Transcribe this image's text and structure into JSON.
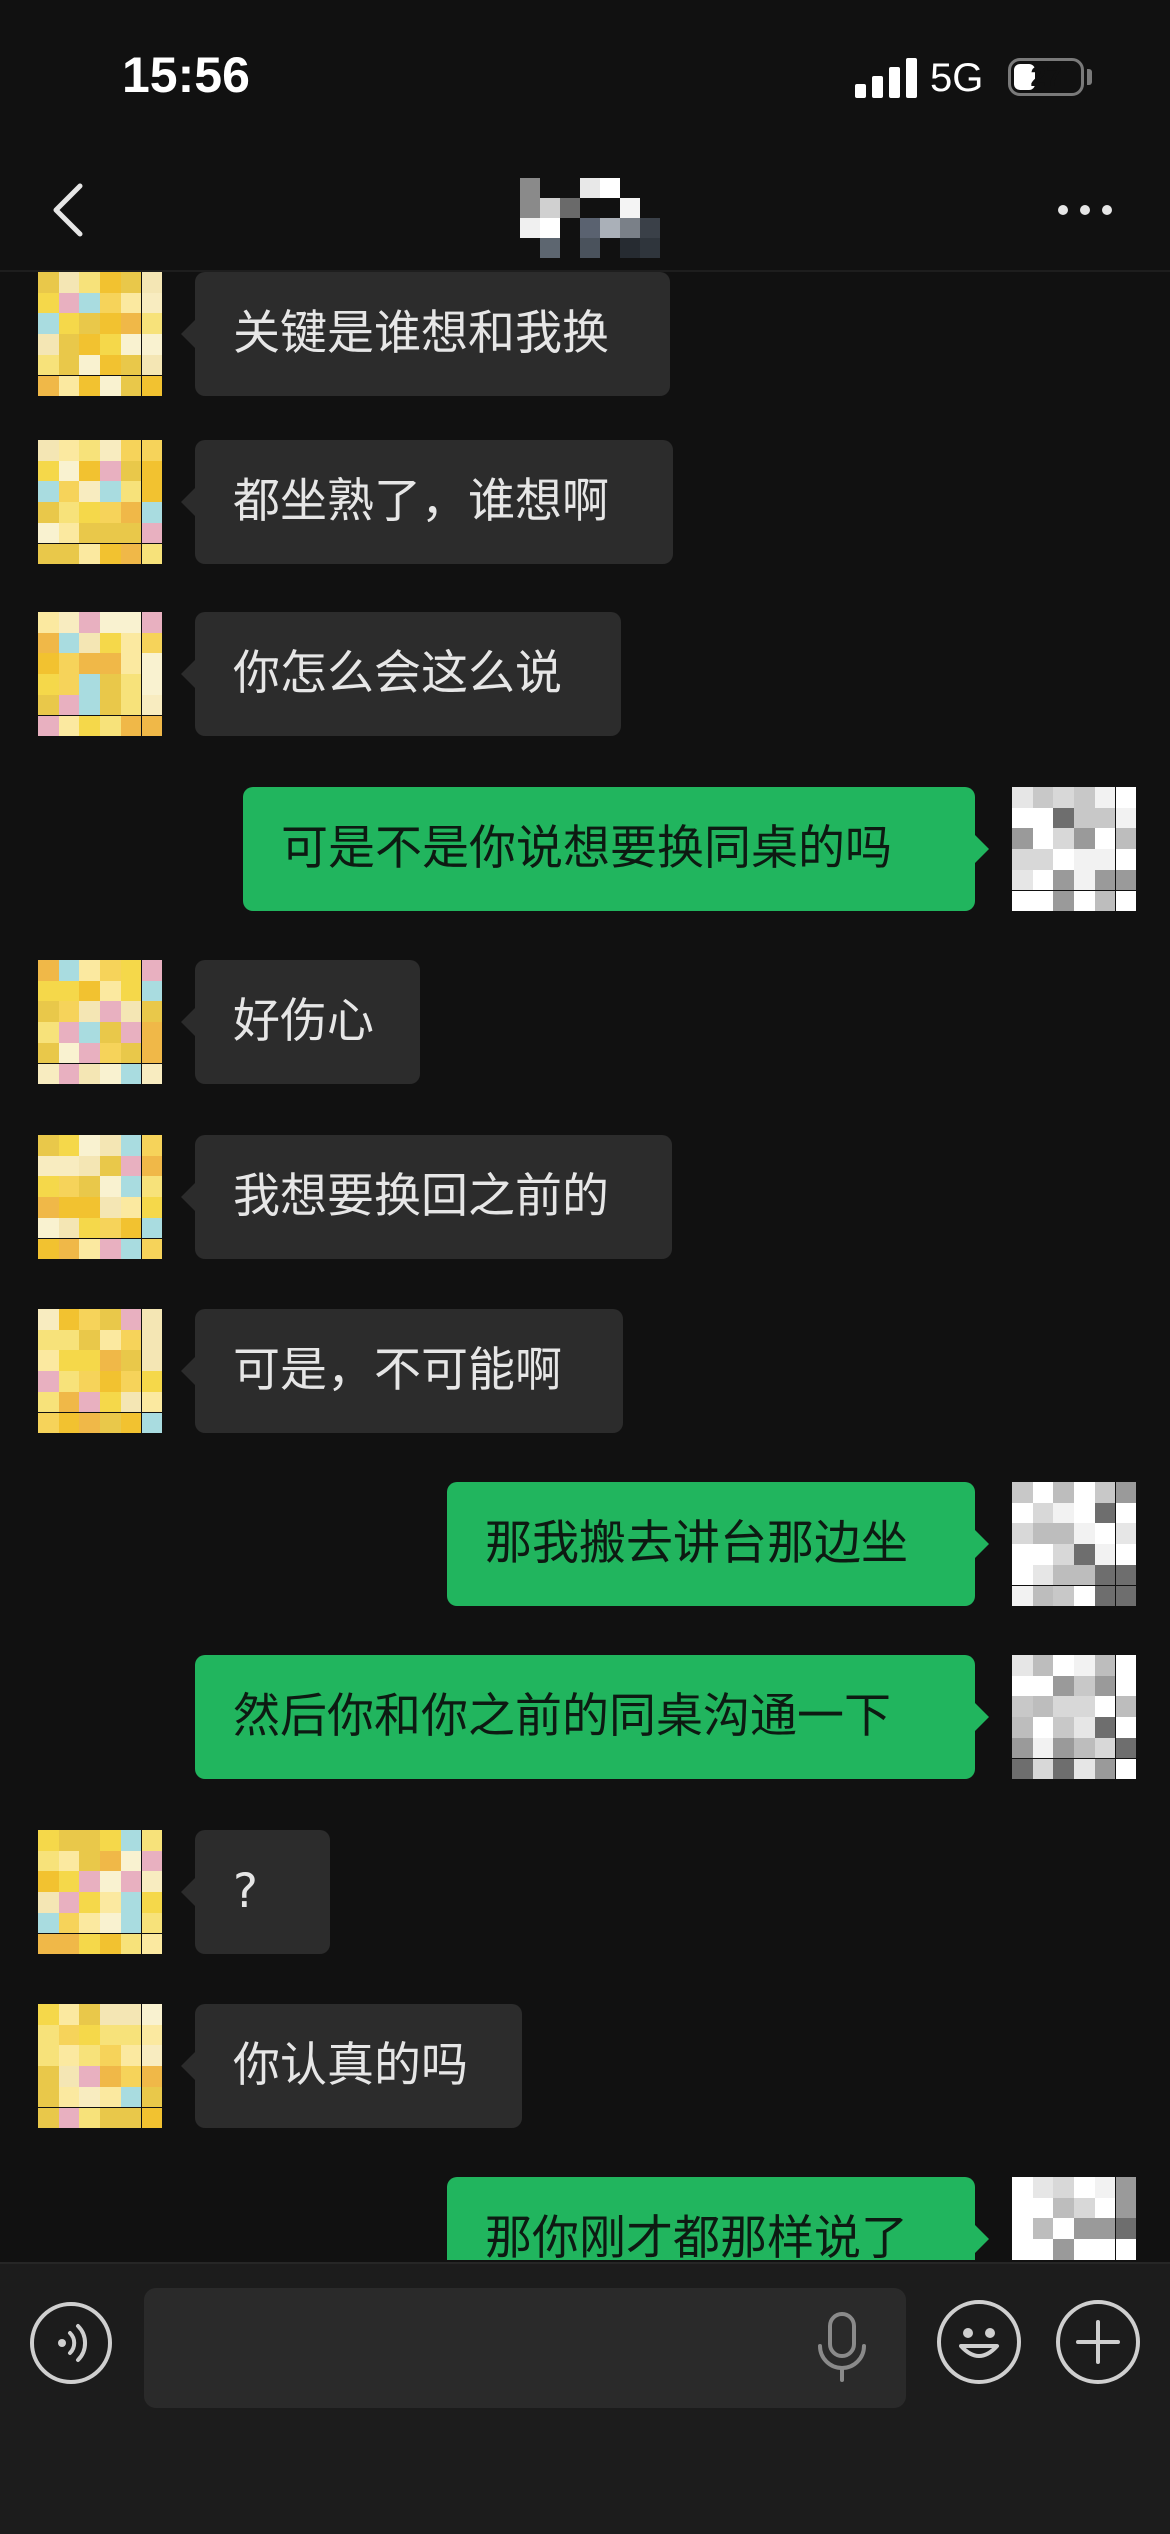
{
  "status_bar": {
    "time": "15:56",
    "network": "5G",
    "battery": "27"
  },
  "nav": {
    "title_icon": "pixelated-contact-name",
    "back_icon": "chevron-left-icon",
    "more_icon": "more-dots-icon"
  },
  "colors": {
    "background": "#111111",
    "bubble_received": "#2c2c2c",
    "bubble_sent": "#21b55e",
    "input_bar": "#1c1c1c"
  },
  "messages": [
    {
      "side": "left",
      "text": "关键是谁想和我换"
    },
    {
      "side": "left",
      "text": "都坐熟了，谁想啊"
    },
    {
      "side": "left",
      "text": "你怎么会这么说"
    },
    {
      "side": "right",
      "text": "可是不是你说想要换同桌的吗"
    },
    {
      "side": "left",
      "text": "好伤心"
    },
    {
      "side": "left",
      "text": "我想要换回之前的"
    },
    {
      "side": "left",
      "text": "可是，不可能啊"
    },
    {
      "side": "right",
      "text": "那我搬去讲台那边坐"
    },
    {
      "side": "right",
      "text": "然后你和你之前的同桌沟通一下"
    },
    {
      "side": "left",
      "text": "?"
    },
    {
      "side": "left",
      "text": "你认真的吗"
    },
    {
      "side": "right",
      "text": "那你刚才都那样说了"
    }
  ],
  "input_bar": {
    "voice_icon": "voice-mode-icon",
    "input_value": "",
    "mic_icon": "microphone-icon",
    "emoji_icon": "emoji-icon",
    "add_icon": "plus-icon"
  }
}
